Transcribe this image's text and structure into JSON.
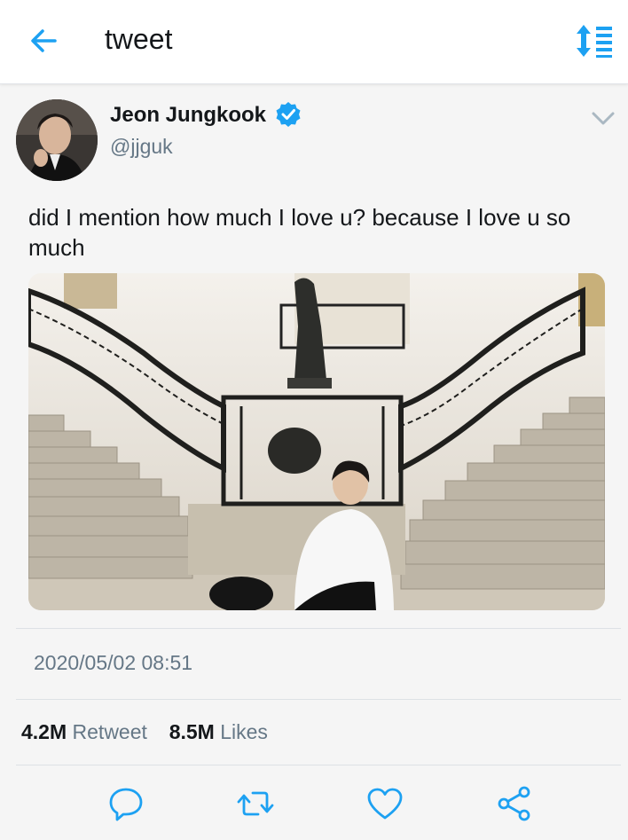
{
  "header": {
    "title": "tweet",
    "back_icon": "arrow-left-icon",
    "sort_icon": "sort-icon"
  },
  "tweet": {
    "name": "Jeon Jungkook",
    "handle": "@jjguk",
    "verified": true,
    "text": "did I mention how much I love u? because I love u so much",
    "timestamp": "2020/05/02 08:51",
    "stats": {
      "retweets": "4.2M",
      "retweet_label": "Retweet",
      "likes": "8.5M",
      "likes_label": "Likes"
    }
  },
  "colors": {
    "accent": "#1da1f2",
    "text": "#14171a",
    "muted": "#657786",
    "background": "#f5f5f5"
  },
  "actions": [
    "reply-icon",
    "retweet-icon",
    "like-icon",
    "share-icon"
  ]
}
